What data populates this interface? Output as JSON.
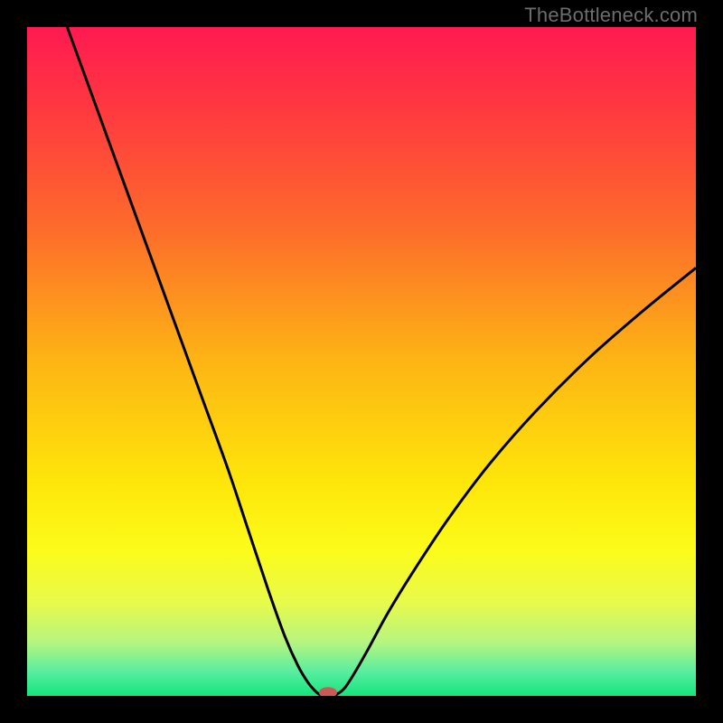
{
  "watermark": "TheBottleneck.com",
  "chart_data": {
    "type": "line",
    "title": "",
    "xlabel": "",
    "ylabel": "",
    "xlim": [
      0,
      100
    ],
    "ylim": [
      0,
      100
    ],
    "grid": false,
    "legend": false,
    "background_gradient": {
      "stops": [
        {
          "offset": 0.0,
          "color": "#ff1a51"
        },
        {
          "offset": 0.12,
          "color": "#ff3840"
        },
        {
          "offset": 0.3,
          "color": "#fd6b2b"
        },
        {
          "offset": 0.5,
          "color": "#fdb514"
        },
        {
          "offset": 0.68,
          "color": "#fee60a"
        },
        {
          "offset": 0.78,
          "color": "#fcfb19"
        },
        {
          "offset": 0.86,
          "color": "#e8fa4a"
        },
        {
          "offset": 0.92,
          "color": "#b6f580"
        },
        {
          "offset": 0.965,
          "color": "#56eda0"
        },
        {
          "offset": 1.0,
          "color": "#14e57c"
        }
      ]
    },
    "series": [
      {
        "name": "curve",
        "color": "#000000",
        "x": [
          6,
          10,
          14,
          18,
          22,
          26,
          30,
          33,
          36,
          38.5,
          40.5,
          42,
          43,
          43.6,
          44,
          46,
          46.4,
          47.5,
          49,
          51,
          54,
          58,
          63,
          69,
          76,
          84,
          92,
          100
        ],
        "y": [
          100,
          89,
          78,
          67,
          56,
          45,
          34,
          25,
          16,
          9,
          4.5,
          2,
          0.8,
          0.3,
          0.2,
          0.2,
          0.3,
          1.2,
          3.5,
          7,
          12.5,
          19,
          26.5,
          34.5,
          42.5,
          50.5,
          57.5,
          64
        ]
      }
    ],
    "marker": {
      "name": "min-marker",
      "x": 45,
      "y": 0.5,
      "color": "#cb5a56",
      "rx": 10,
      "ry": 6
    }
  }
}
